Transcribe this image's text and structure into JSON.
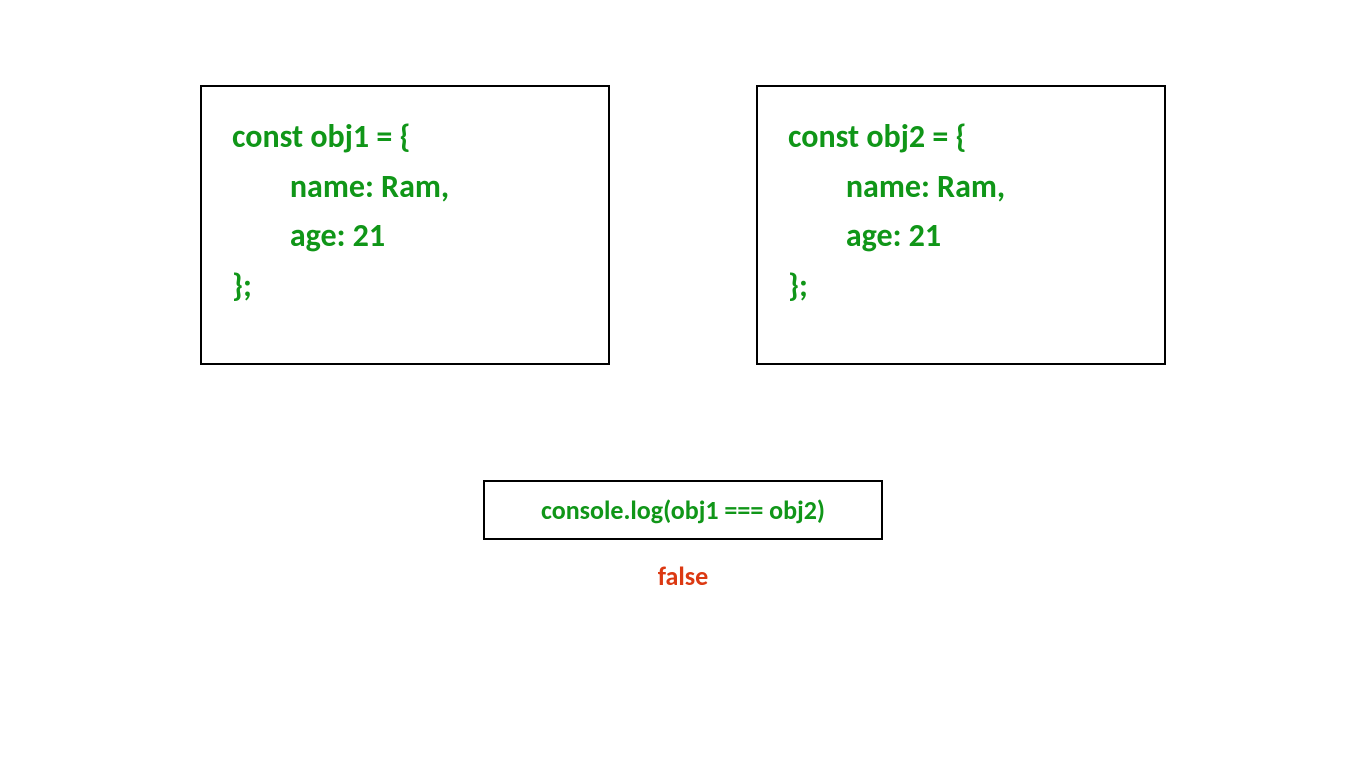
{
  "box1": {
    "line1": "const obj1 = {",
    "line2": "        name: Ram,",
    "line3": "        age: 21",
    "line4": "};"
  },
  "box2": {
    "line1": "const obj2 = {",
    "line2": "        name: Ram,",
    "line3": "        age: 21",
    "line4": "};"
  },
  "console": {
    "statement": "console.log(obj1 === obj2)"
  },
  "result": {
    "value": "false"
  }
}
